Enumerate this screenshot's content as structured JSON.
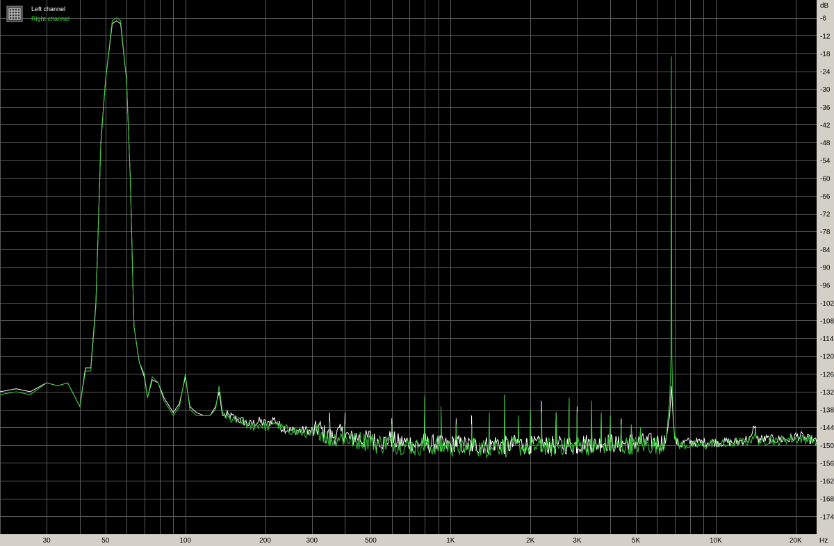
{
  "colors": {
    "background": "#000000",
    "grid": "#5a5a5a",
    "frame": "#d4d0c8",
    "left_channel": "#ffffff",
    "right_channel": "#33cc33"
  },
  "legend": {
    "icon": "grid-icon",
    "items": [
      {
        "label": "Left channel",
        "color": "#ffffff"
      },
      {
        "label": "Right channel",
        "color": "#33cc33"
      }
    ]
  },
  "chart_data": {
    "type": "line",
    "title": "",
    "x_scale": "log",
    "xlim": [
      20,
      24000
    ],
    "ylim": [
      -180,
      0
    ],
    "y_unit": "dB",
    "x_unit": "Hz",
    "grid": true,
    "legend_position": "top-left",
    "y_ticks": [
      -6,
      -12,
      -18,
      -24,
      -30,
      -36,
      -42,
      -48,
      -54,
      -60,
      -66,
      -72,
      -78,
      -84,
      -90,
      -96,
      -102,
      -108,
      -114,
      -120,
      -126,
      -132,
      -138,
      -144,
      -150,
      -156,
      -162,
      -168,
      -174
    ],
    "x_ticks": [
      {
        "value": 30,
        "label": "30"
      },
      {
        "value": 50,
        "label": "50"
      },
      {
        "value": 100,
        "label": "100"
      },
      {
        "value": 200,
        "label": "200"
      },
      {
        "value": 300,
        "label": "300"
      },
      {
        "value": 500,
        "label": "500"
      },
      {
        "value": 1000,
        "label": "1K"
      },
      {
        "value": 2000,
        "label": "2K"
      },
      {
        "value": 3000,
        "label": "3K"
      },
      {
        "value": 5000,
        "label": "5K"
      },
      {
        "value": 10000,
        "label": "10K"
      },
      {
        "value": 20000,
        "label": "20K"
      }
    ],
    "series": [
      {
        "name": "Left channel",
        "color": "#ffffff",
        "points": [
          [
            20,
            -132
          ],
          [
            23,
            -131
          ],
          [
            26,
            -132
          ],
          [
            30,
            -129
          ],
          [
            33,
            -130
          ],
          [
            36,
            -129
          ],
          [
            40,
            -137
          ],
          [
            42,
            -124
          ],
          [
            44,
            -124
          ],
          [
            46,
            -102
          ],
          [
            48,
            -48
          ],
          [
            50,
            -27
          ],
          [
            53,
            -8
          ],
          [
            55,
            -7
          ],
          [
            57,
            -8
          ],
          [
            60,
            -27
          ],
          [
            62,
            -60
          ],
          [
            64,
            -110
          ],
          [
            67,
            -122
          ],
          [
            70,
            -127
          ],
          [
            72,
            -134
          ],
          [
            75,
            -128
          ],
          [
            79,
            -129
          ],
          [
            83,
            -134
          ],
          [
            90,
            -139
          ],
          [
            95,
            -136
          ],
          [
            100,
            -127
          ],
          [
            104,
            -137
          ],
          [
            110,
            -139
          ],
          [
            117,
            -140
          ],
          [
            124,
            -140
          ],
          [
            130,
            -137
          ],
          [
            134,
            -132
          ],
          [
            138,
            -140
          ],
          [
            145,
            -140
          ],
          [
            155,
            -141
          ],
          [
            165,
            -142
          ],
          [
            175,
            -143
          ],
          [
            190,
            -142
          ],
          [
            205,
            -143
          ],
          [
            215,
            -141
          ],
          [
            230,
            -144
          ],
          [
            250,
            -145
          ],
          [
            270,
            -145
          ],
          [
            290,
            -145
          ],
          [
            300,
            -146
          ],
          [
            320,
            -144
          ],
          [
            340,
            -147
          ],
          [
            360,
            -147
          ],
          [
            380,
            -146
          ],
          [
            400,
            -146
          ],
          [
            420,
            -148
          ],
          [
            440,
            -147
          ],
          [
            460,
            -148
          ],
          [
            480,
            -148
          ],
          [
            500,
            -147
          ],
          [
            520,
            -149
          ],
          [
            540,
            -148
          ],
          [
            560,
            -149
          ],
          [
            580,
            -148
          ],
          [
            600,
            -148
          ],
          [
            630,
            -149
          ],
          [
            660,
            -149
          ],
          [
            700,
            -149
          ],
          [
            740,
            -150
          ],
          [
            780,
            -149
          ],
          [
            800,
            -149
          ],
          [
            840,
            -150
          ],
          [
            880,
            -149
          ],
          [
            920,
            -150
          ],
          [
            960,
            -150
          ],
          [
            1000,
            -150
          ],
          [
            1050,
            -149
          ],
          [
            1100,
            -150
          ],
          [
            1150,
            -150
          ],
          [
            1200,
            -150
          ],
          [
            1300,
            -150
          ],
          [
            1400,
            -150
          ],
          [
            1500,
            -149
          ],
          [
            1600,
            -150
          ],
          [
            1700,
            -150
          ],
          [
            1800,
            -149
          ],
          [
            1900,
            -150
          ],
          [
            2000,
            -150
          ],
          [
            2200,
            -150
          ],
          [
            2400,
            -150
          ],
          [
            2600,
            -150
          ],
          [
            2800,
            -150
          ],
          [
            3000,
            -150
          ],
          [
            3200,
            -149
          ],
          [
            3500,
            -150
          ],
          [
            3800,
            -149
          ],
          [
            4000,
            -149
          ],
          [
            4300,
            -150
          ],
          [
            4600,
            -149
          ],
          [
            5000,
            -149
          ],
          [
            5400,
            -149
          ],
          [
            5800,
            -149
          ],
          [
            6200,
            -149
          ],
          [
            6500,
            -148
          ],
          [
            6700,
            -140
          ],
          [
            6800,
            -130
          ],
          [
            6900,
            -140
          ],
          [
            7000,
            -148
          ],
          [
            7300,
            -150
          ],
          [
            7600,
            -149
          ],
          [
            8000,
            -149
          ],
          [
            8600,
            -149
          ],
          [
            9200,
            -149
          ],
          [
            10000,
            -149
          ],
          [
            11000,
            -149
          ],
          [
            12000,
            -149
          ],
          [
            13000,
            -148
          ],
          [
            13600,
            -148
          ],
          [
            14000,
            -143
          ],
          [
            14300,
            -148
          ],
          [
            15000,
            -148
          ],
          [
            16000,
            -148
          ],
          [
            17000,
            -148
          ],
          [
            18000,
            -148
          ],
          [
            19000,
            -148
          ],
          [
            20000,
            -147
          ],
          [
            21000,
            -147
          ],
          [
            22000,
            -148
          ],
          [
            23000,
            -148
          ],
          [
            24000,
            -149
          ]
        ]
      },
      {
        "name": "Right channel",
        "color": "#33cc33",
        "points": [
          [
            20,
            -133
          ],
          [
            23,
            -132
          ],
          [
            26,
            -133
          ],
          [
            30,
            -129
          ],
          [
            33,
            -130
          ],
          [
            36,
            -129
          ],
          [
            40,
            -137
          ],
          [
            42,
            -125
          ],
          [
            44,
            -125
          ],
          [
            46,
            -103
          ],
          [
            48,
            -49
          ],
          [
            50,
            -27
          ],
          [
            53,
            -7
          ],
          [
            55,
            -6
          ],
          [
            57,
            -7
          ],
          [
            60,
            -27
          ],
          [
            62,
            -60
          ],
          [
            64,
            -110
          ],
          [
            67,
            -122
          ],
          [
            70,
            -126
          ],
          [
            72,
            -134
          ],
          [
            75,
            -127
          ],
          [
            79,
            -129
          ],
          [
            83,
            -135
          ],
          [
            90,
            -140
          ],
          [
            95,
            -137
          ],
          [
            100,
            -126
          ],
          [
            104,
            -138
          ],
          [
            110,
            -140
          ],
          [
            117,
            -140
          ],
          [
            124,
            -140
          ],
          [
            130,
            -138
          ],
          [
            134,
            -130
          ],
          [
            138,
            -139
          ],
          [
            145,
            -141
          ],
          [
            155,
            -142
          ],
          [
            165,
            -142
          ],
          [
            175,
            -144
          ],
          [
            190,
            -143
          ],
          [
            205,
            -144
          ],
          [
            215,
            -142
          ],
          [
            230,
            -144
          ],
          [
            250,
            -145
          ],
          [
            270,
            -146
          ],
          [
            290,
            -146
          ],
          [
            300,
            -147
          ],
          [
            320,
            -145
          ],
          [
            340,
            -147
          ],
          [
            360,
            -148
          ],
          [
            380,
            -147
          ],
          [
            400,
            -148
          ],
          [
            420,
            -148
          ],
          [
            440,
            -149
          ],
          [
            460,
            -148
          ],
          [
            480,
            -149
          ],
          [
            500,
            -148
          ],
          [
            520,
            -150
          ],
          [
            540,
            -149
          ],
          [
            560,
            -150
          ],
          [
            580,
            -149
          ],
          [
            600,
            -149
          ],
          [
            630,
            -150
          ],
          [
            660,
            -150
          ],
          [
            700,
            -150
          ],
          [
            740,
            -151
          ],
          [
            780,
            -150
          ],
          [
            800,
            -150
          ],
          [
            840,
            -151
          ],
          [
            880,
            -150
          ],
          [
            920,
            -151
          ],
          [
            960,
            -150
          ],
          [
            1000,
            -151
          ],
          [
            1050,
            -150
          ],
          [
            1100,
            -151
          ],
          [
            1150,
            -151
          ],
          [
            1200,
            -150
          ],
          [
            1300,
            -151
          ],
          [
            1400,
            -151
          ],
          [
            1500,
            -150
          ],
          [
            1600,
            -151
          ],
          [
            1700,
            -150
          ],
          [
            1800,
            -151
          ],
          [
            1900,
            -150
          ],
          [
            2000,
            -151
          ],
          [
            2200,
            -150
          ],
          [
            2400,
            -151
          ],
          [
            2600,
            -150
          ],
          [
            2800,
            -151
          ],
          [
            3000,
            -150
          ],
          [
            3200,
            -150
          ],
          [
            3500,
            -151
          ],
          [
            3800,
            -150
          ],
          [
            4000,
            -150
          ],
          [
            4300,
            -151
          ],
          [
            4600,
            -150
          ],
          [
            5000,
            -150
          ],
          [
            5400,
            -150
          ],
          [
            5800,
            -150
          ],
          [
            6200,
            -150
          ],
          [
            6500,
            -148
          ],
          [
            6700,
            -135
          ],
          [
            6780,
            -120
          ],
          [
            6800,
            -19
          ],
          [
            6830,
            -120
          ],
          [
            6900,
            -138
          ],
          [
            7000,
            -148
          ],
          [
            7300,
            -150
          ],
          [
            7600,
            -150
          ],
          [
            8000,
            -150
          ],
          [
            8600,
            -150
          ],
          [
            9200,
            -150
          ],
          [
            10000,
            -149
          ],
          [
            11000,
            -150
          ],
          [
            12000,
            -149
          ],
          [
            13000,
            -149
          ],
          [
            13600,
            -148
          ],
          [
            14000,
            -146
          ],
          [
            14300,
            -148
          ],
          [
            15000,
            -149
          ],
          [
            16000,
            -148
          ],
          [
            17000,
            -149
          ],
          [
            18000,
            -148
          ],
          [
            19000,
            -148
          ],
          [
            20000,
            -148
          ],
          [
            21000,
            -148
          ],
          [
            22000,
            -148
          ],
          [
            23000,
            -148
          ],
          [
            24000,
            -149
          ]
        ]
      }
    ],
    "spurs": [
      {
        "freq": 350,
        "left": -139,
        "right": -142
      },
      {
        "freq": 400,
        "left": -139,
        "right": -143
      },
      {
        "freq": 600,
        "left": -141,
        "right": -143
      },
      {
        "freq": 800,
        "left": -134,
        "right": -133
      },
      {
        "freq": 920,
        "left": -139,
        "right": -137
      },
      {
        "freq": 1050,
        "left": -141,
        "right": -143
      },
      {
        "freq": 1200,
        "left": -140,
        "right": -143
      },
      {
        "freq": 1400,
        "left": -142,
        "right": -139
      },
      {
        "freq": 1600,
        "left": -133,
        "right": -133
      },
      {
        "freq": 1800,
        "left": -142,
        "right": -140
      },
      {
        "freq": 2000,
        "left": -141,
        "right": -138
      },
      {
        "freq": 2200,
        "left": -135,
        "right": -139
      },
      {
        "freq": 2500,
        "left": -139,
        "right": -139
      },
      {
        "freq": 2800,
        "left": -135,
        "right": -134
      },
      {
        "freq": 3000,
        "left": -137,
        "right": -139
      },
      {
        "freq": 3400,
        "left": -138,
        "right": -135
      },
      {
        "freq": 3700,
        "left": -141,
        "right": -139
      },
      {
        "freq": 4000,
        "left": -143,
        "right": -140
      },
      {
        "freq": 4400,
        "left": -141,
        "right": -143
      },
      {
        "freq": 4800,
        "left": -144,
        "right": -143
      },
      {
        "freq": 5200,
        "left": -145,
        "right": -144
      }
    ]
  }
}
